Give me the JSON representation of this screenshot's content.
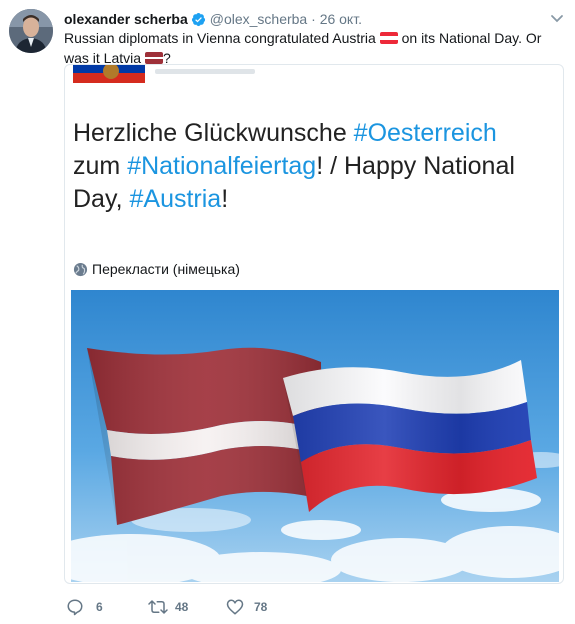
{
  "author": {
    "name": "olexander scherba",
    "handle": "@olex_scherba",
    "separator": "·",
    "date": "26 окт."
  },
  "tweet": {
    "text_part1": "Russian diplomats in Vienna congratulated Austria",
    "text_part2": "on its National Day. Or was it Latvia",
    "text_part3": "?"
  },
  "quote": {
    "line1_text": "Herzliche Glückwunsche ",
    "line1_hashtag": "#Oesterreich",
    "line2_text_a": "zum ",
    "line2_hashtag": "#Nationalfeiertag",
    "line2_text_b": "! / Happy National",
    "line3_text": "Day, ",
    "line3_hashtag": "#Austria",
    "line3_end": "!",
    "translate_label": "Перекласти (німецька)"
  },
  "actions": {
    "replies": "6",
    "retweets": "48",
    "likes": "78"
  },
  "colors": {
    "link": "#1b95e0",
    "muted": "#657786",
    "verified": "#1da1f2",
    "latvia_red": "#9e3039",
    "austria_red": "#ed2939",
    "sky": "#3f95d6"
  }
}
